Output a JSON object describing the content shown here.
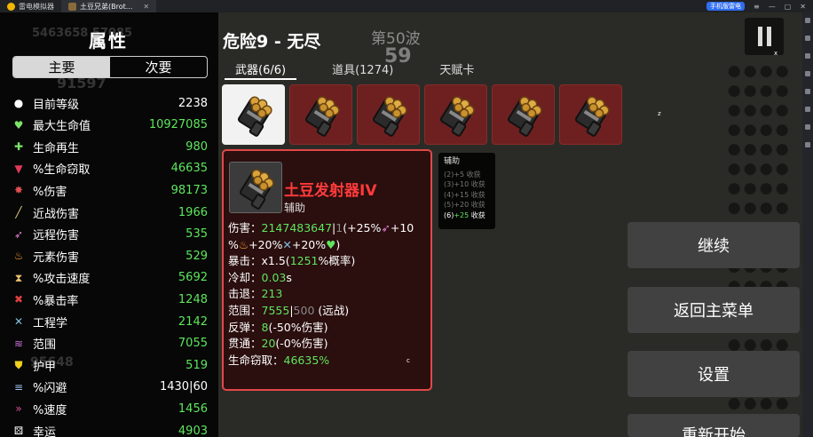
{
  "titlebar": {
    "app_tab": "雷电模拟器",
    "game_tab": "土豆兄弟(Brot...",
    "badge": "手机版雷电"
  },
  "left_panel": {
    "title": "属性",
    "tabs": [
      {
        "label": "主要",
        "active": true
      },
      {
        "label": "次要",
        "active": false
      }
    ],
    "stats": [
      {
        "icon": "level-icon",
        "glyph": "●",
        "color": "#ffffff",
        "name": "目前等级",
        "value": "2238",
        "green": false
      },
      {
        "icon": "heart-icon",
        "glyph": "♥",
        "color": "#7de36a",
        "name": "最大生命值",
        "value": "10927085",
        "green": true
      },
      {
        "icon": "regen-icon",
        "glyph": "✚",
        "color": "#7de36a",
        "name": "生命再生",
        "value": "980",
        "green": true
      },
      {
        "icon": "lifesteal-icon",
        "glyph": "▼",
        "color": "#e03a5a",
        "name": "%生命窃取",
        "value": "46635",
        "green": true
      },
      {
        "icon": "damage-icon",
        "glyph": "✸",
        "color": "#e05050",
        "name": "%伤害",
        "value": "98173",
        "green": true
      },
      {
        "icon": "melee-icon",
        "glyph": "╱",
        "color": "#e8d080",
        "name": "近战伤害",
        "value": "1966",
        "green": true
      },
      {
        "icon": "ranged-icon",
        "glyph": "➶",
        "color": "#e080d0",
        "name": "远程伤害",
        "value": "535",
        "green": true
      },
      {
        "icon": "elemental-icon",
        "glyph": "♨",
        "color": "#f0a030",
        "name": "元素伤害",
        "value": "529",
        "green": true
      },
      {
        "icon": "attack-speed-icon",
        "glyph": "⧗",
        "color": "#f0c070",
        "name": "%攻击速度",
        "value": "5692",
        "green": true
      },
      {
        "icon": "crit-icon",
        "glyph": "✖",
        "color": "#e04040",
        "name": "%暴击率",
        "value": "1248",
        "green": true
      },
      {
        "icon": "engineering-icon",
        "glyph": "✕",
        "color": "#80c0e0",
        "name": "工程学",
        "value": "2142",
        "green": true
      },
      {
        "icon": "range-icon",
        "glyph": "≋",
        "color": "#d070e0",
        "name": "范围",
        "value": "7055",
        "green": true
      },
      {
        "icon": "armor-icon",
        "glyph": "⛊",
        "color": "#f0d020",
        "name": "护甲",
        "value": "519",
        "green": true
      },
      {
        "icon": "dodge-icon",
        "glyph": "≡",
        "color": "#a0c0f0",
        "name": "%闪避",
        "value": "1430|60",
        "green": false
      },
      {
        "icon": "speed-icon",
        "glyph": "»",
        "color": "#e050a0",
        "name": "%速度",
        "value": "1456",
        "green": true
      },
      {
        "icon": "luck-icon",
        "glyph": "⚄",
        "color": "#ffffff",
        "name": "幸运",
        "value": "4903",
        "green": true
      }
    ]
  },
  "header": {
    "title": "危险9 - 无尽",
    "wave": "第50波",
    "timer": "59"
  },
  "tabs": [
    {
      "label": "武器(6/6)",
      "active": true
    },
    {
      "label": "道具(1274)",
      "active": false
    },
    {
      "label": "天赋卡",
      "active": false
    }
  ],
  "weapon_slots": 6,
  "item_card": {
    "name": "土豆发射器IV",
    "tag": "辅助",
    "stats": {
      "damage_label": "伤害：",
      "damage_value": "2147483647",
      "damage_sep": "|",
      "damage_base": "1",
      "damage_scaling_1": "(+25%",
      "damage_scaling_2": "+10",
      "damage_scaling_3": "%",
      "damage_scaling_4": "+20%",
      "damage_scaling_5": "+20%",
      "damage_scaling_6": ")",
      "crit_label": "暴击：",
      "crit_value": "x1.5",
      "crit_open": "(",
      "crit_chance": "1251",
      "crit_close": "%概率)",
      "cooldown_label": "冷却：",
      "cooldown_value": "0.03",
      "cooldown_unit": "s",
      "knockback_label": "击退：",
      "knockback_value": "213",
      "range_label": "范围：",
      "range_value": "7555",
      "range_sep": "|",
      "range_base": "500",
      "range_type": " (远战)",
      "bounce_label": "反弹：",
      "bounce_value": "8",
      "bounce_rest": "(-50%伤害)",
      "pierce_label": "贯通：",
      "pierce_value": "20",
      "pierce_rest": "(-0%伤害)",
      "lifesteal_label": "生命窃取：",
      "lifesteal_value": "46635%"
    }
  },
  "set_bonus": {
    "title": "辅助",
    "lines": [
      {
        "text": "(2)+5 收获",
        "active": false
      },
      {
        "text": "(3)+10 收获",
        "active": false
      },
      {
        "text": "(4)+15 收获",
        "active": false
      },
      {
        "text": "(5)+20 收获",
        "active": false
      },
      {
        "count": "(6)",
        "amount": "+25",
        "stat": " 收获",
        "active": true
      }
    ]
  },
  "menu": {
    "continue": "继续",
    "main_menu": "返回主菜单",
    "settings": "设置",
    "restart": "重新开始"
  },
  "bg_numbers": {
    "top_left": "5463658  57085",
    "mid_left": "91597",
    "bottom_left": "95648"
  },
  "stray_marks": {
    "a": "x",
    "b": "z",
    "c": "c"
  },
  "colors": {
    "stat_green": "#5ee65e",
    "card_border": "#e24848",
    "card_name": "#ff3b3b",
    "slot_red": "#6e2020"
  }
}
